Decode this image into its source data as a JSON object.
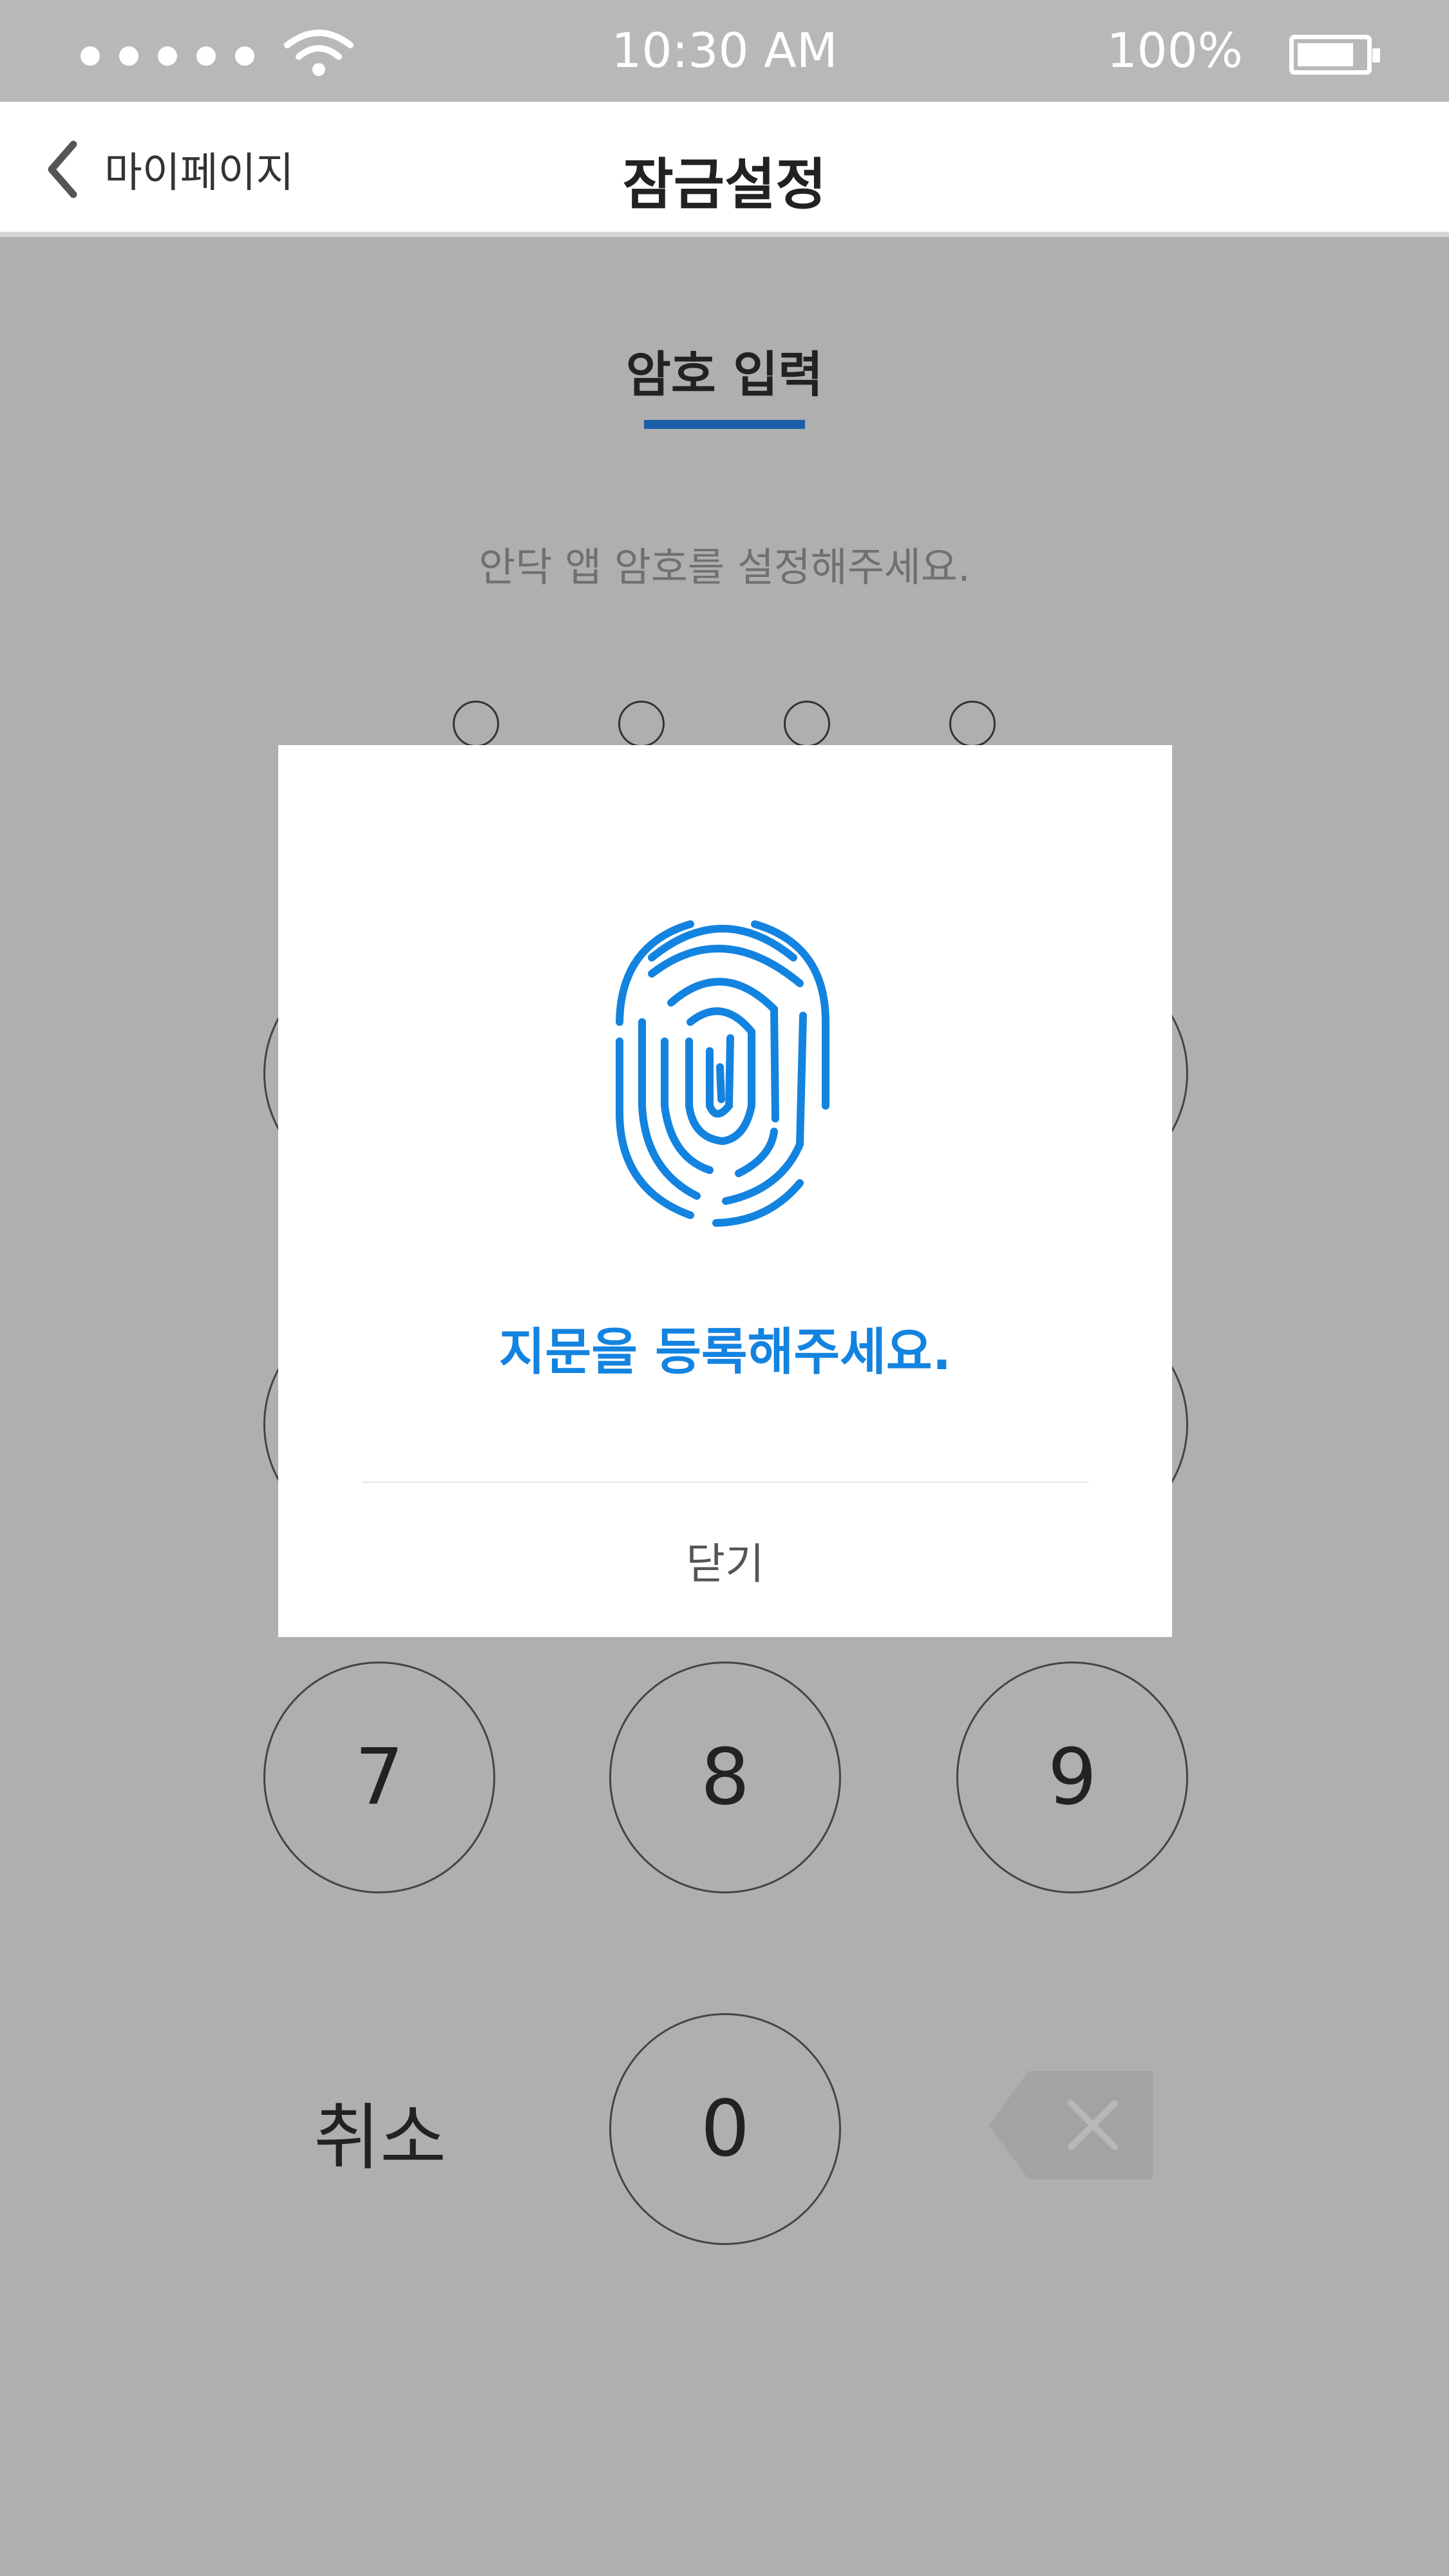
{
  "status_bar": {
    "time": "10:30 AM",
    "battery_percent": "100%",
    "signal_icon": "signal-dots-icon",
    "wifi_icon": "wifi-icon",
    "battery_icon": "battery-icon"
  },
  "nav": {
    "back_label": "마이페이지",
    "back_icon": "chevron-left-icon",
    "title": "잠금설정"
  },
  "content": {
    "tab_title": "암호 입력",
    "instruction": "안닥 앱 암호를 설정해주세요.",
    "pin_length": 4
  },
  "keypad": {
    "keys": [
      "7",
      "8",
      "9",
      "0"
    ],
    "cancel_label": "취소",
    "delete_icon": "backspace-icon"
  },
  "modal": {
    "icon": "fingerprint-icon",
    "message": "지문을 등록해주세요.",
    "close_label": "닫기"
  },
  "colors": {
    "accent": "#1383e0",
    "tab_underline": "#1a5ea8",
    "overlay_background": "#afafaf",
    "status_bar_background": "#b9b7b8"
  }
}
